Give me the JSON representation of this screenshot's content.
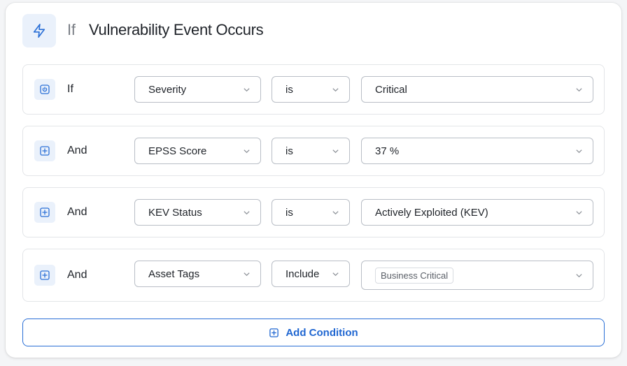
{
  "header": {
    "prefix": "If",
    "title": "Vulnerability Event Occurs",
    "icon": "lightning-icon"
  },
  "conditions": [
    {
      "connector": "If",
      "field": "Severity",
      "operator": "is",
      "value": "Critical",
      "icon": "power-icon"
    },
    {
      "connector": "And",
      "field": "EPSS Score",
      "operator": "is",
      "value": "37 %",
      "icon": "plus-square-icon"
    },
    {
      "connector": "And",
      "field": "KEV Status",
      "operator": "is",
      "value": "Actively Exploited (KEV)",
      "icon": "plus-square-icon"
    },
    {
      "connector": "And",
      "field": "Asset Tags",
      "operator": "Include",
      "tags": [
        "Business Critical"
      ],
      "icon": "plus-square-icon"
    }
  ],
  "add_button": {
    "label": "Add Condition",
    "icon": "plus-square-icon"
  },
  "colors": {
    "accent": "#1f66d1",
    "icon_bg": "#eaf1fb",
    "border": "#e3e5e8"
  }
}
